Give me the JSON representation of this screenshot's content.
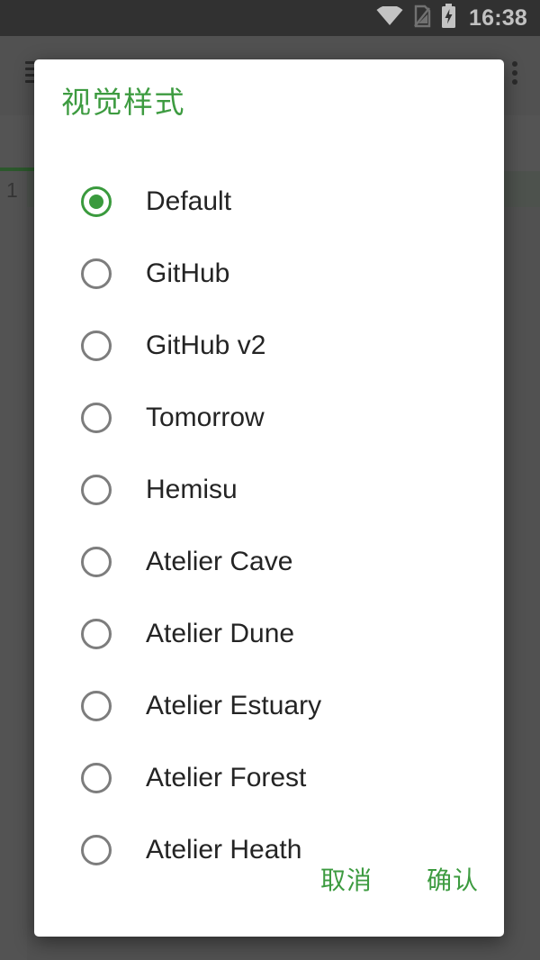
{
  "status_bar": {
    "time": "16:38",
    "icons": [
      "wifi-icon",
      "sim-card-off-icon",
      "battery-charging-icon"
    ],
    "background_color": "#353535"
  },
  "background_app": {
    "menu_icon": "hamburger-menu-icon",
    "overflow_icon": "overflow-menu-icon",
    "tab_label": "*",
    "line_number": "1",
    "accent_color": "#2e6b2e"
  },
  "dialog": {
    "title": "视觉样式",
    "title_color": "#3d9b40",
    "accent_color": "#3a9a3d",
    "selected_index": 0,
    "options": [
      {
        "label": "Default",
        "selected": true
      },
      {
        "label": "GitHub",
        "selected": false
      },
      {
        "label": "GitHub v2",
        "selected": false
      },
      {
        "label": "Tomorrow",
        "selected": false
      },
      {
        "label": "Hemisu",
        "selected": false
      },
      {
        "label": "Atelier Cave",
        "selected": false
      },
      {
        "label": "Atelier Dune",
        "selected": false
      },
      {
        "label": "Atelier Estuary",
        "selected": false
      },
      {
        "label": "Atelier Forest",
        "selected": false
      },
      {
        "label": "Atelier Heath",
        "selected": false
      }
    ],
    "cancel_label": "取消",
    "confirm_label": "确认"
  }
}
